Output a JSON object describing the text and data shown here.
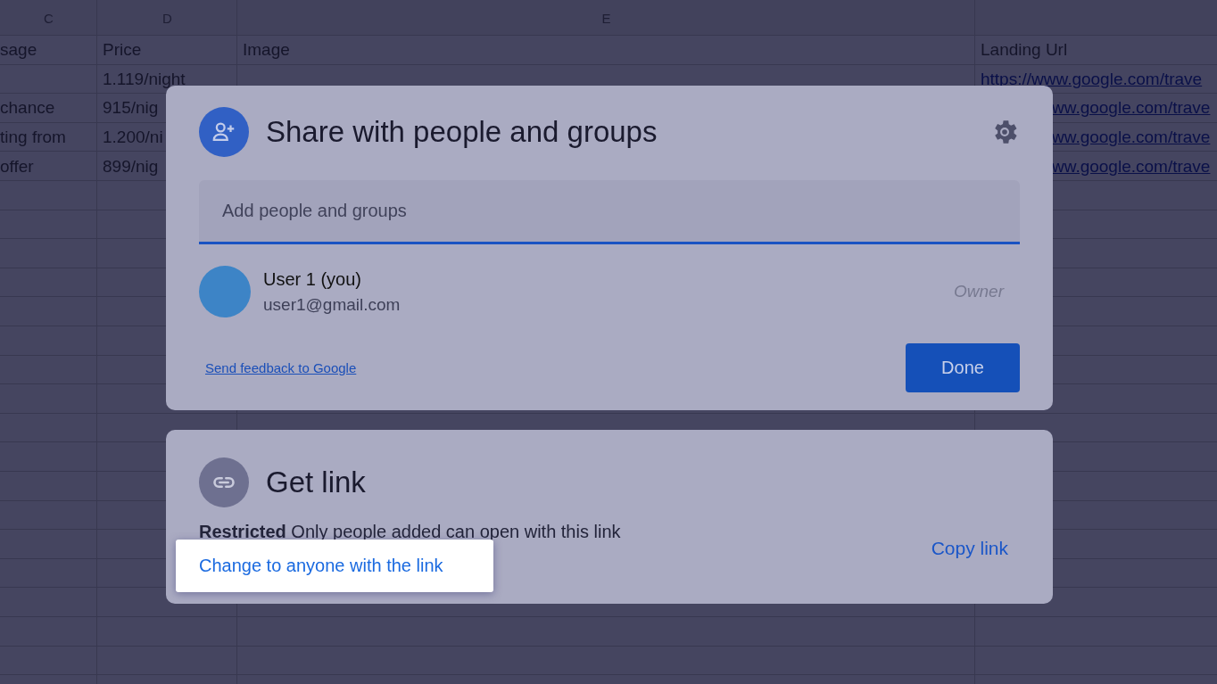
{
  "sheet": {
    "column_headers": [
      "C",
      "D",
      "E"
    ],
    "header_row": [
      "sage",
      "Price",
      "Image",
      "Landing Url"
    ],
    "rows": [
      {
        "c": "",
        "d": "1.119/night",
        "landing": "https://www.google.com/trave"
      },
      {
        "c": "chance",
        "d": "915/nig",
        "landing": "ww.google.com/trave"
      },
      {
        "c": "ting from",
        "d": "1.200/ni",
        "landing": "ww.google.com/trave"
      },
      {
        "c": "offer",
        "d": "899/nig",
        "landing": "ww.google.com/trave"
      }
    ]
  },
  "share_dialog": {
    "title": "Share with people and groups",
    "search": {
      "placeholder": "Add people and groups"
    },
    "people": [
      {
        "name": "User 1 (you)",
        "email": "user1@gmail.com",
        "role": "Owner"
      }
    ],
    "feedback_link": "Send feedback to Google",
    "done_button": "Done"
  },
  "link_dialog": {
    "title": "Get link",
    "access": "**Restricted** Only people added can open with this link",
    "change_link": "Change to anyone with the link",
    "copy_link": "Copy link"
  }
}
